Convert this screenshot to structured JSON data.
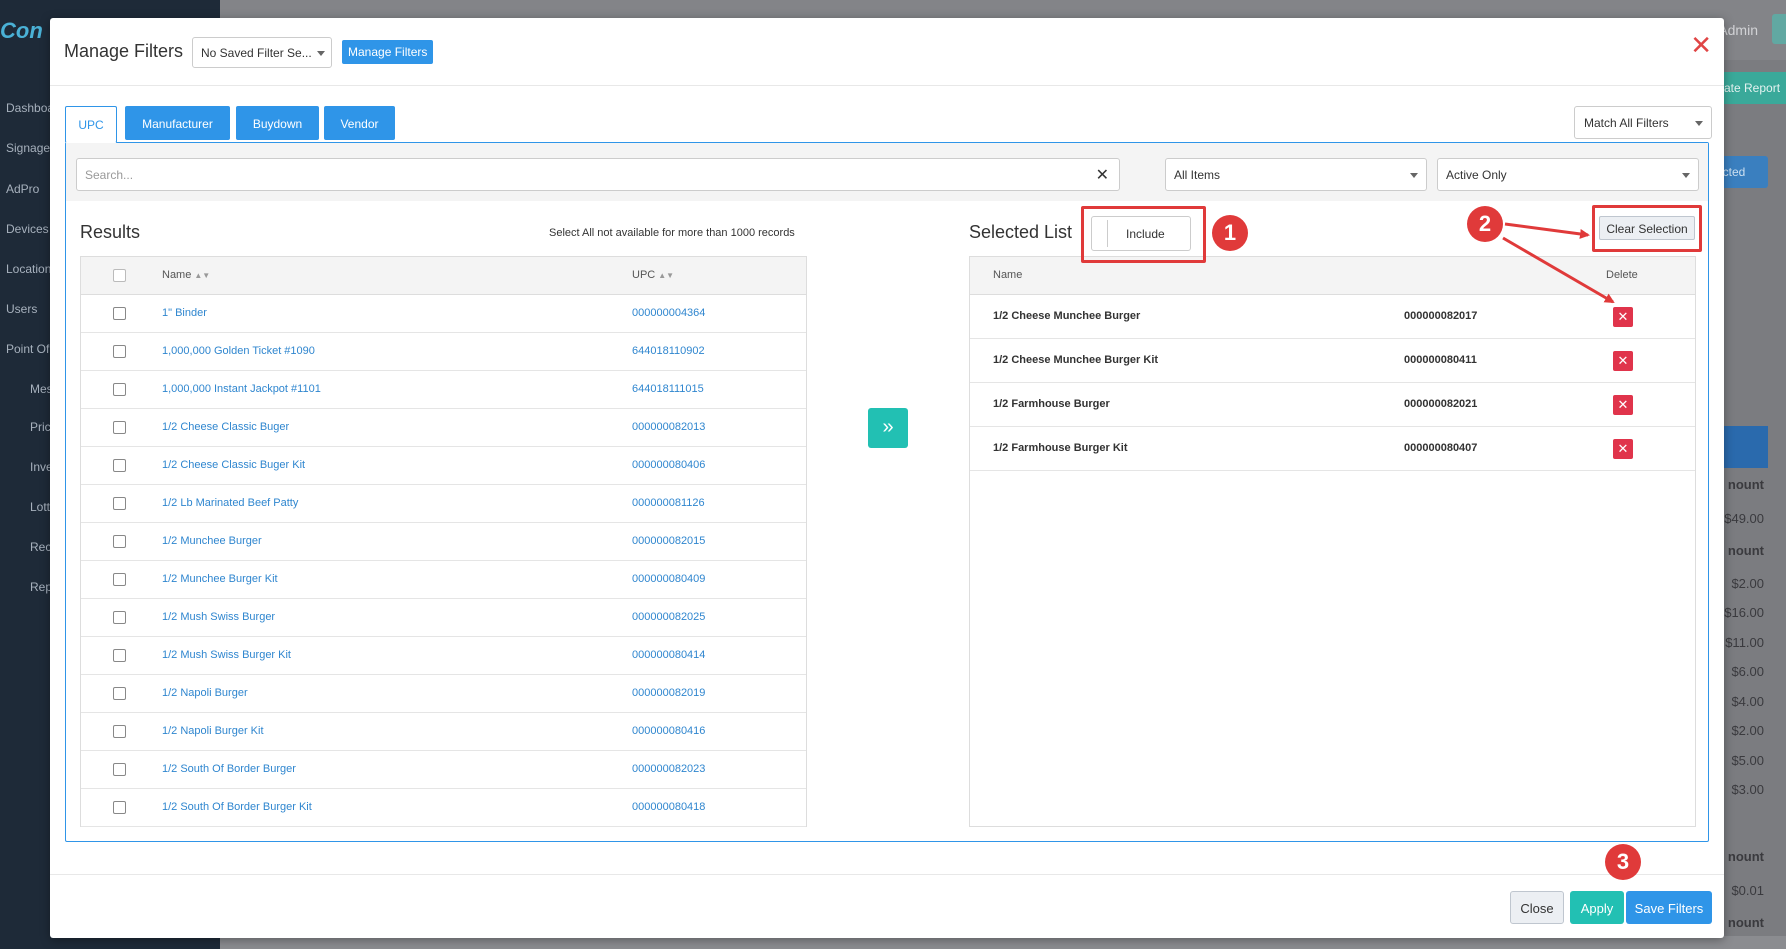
{
  "background": {
    "logo": "Con",
    "admin_label": "Admin",
    "report_btn": "ate Report",
    "selected_btn": "ected",
    "sidebar_items": [
      "Dashboa",
      "Signage",
      "AdPro",
      "Devices",
      "Location",
      "Users",
      "Point Of",
      "Mes",
      "Pric",
      "Inve",
      "Lott",
      "Rec",
      "Rep"
    ],
    "amounts": {
      "h1": "nount",
      "v1": "$49.00",
      "h2": "nount",
      "values": [
        "$2.00",
        "$16.00",
        "$11.00",
        "$6.00",
        "$4.00",
        "$2.00",
        "$5.00",
        "$3.00"
      ],
      "h3": "nount",
      "v3": "$0.01",
      "h4": "nount"
    }
  },
  "modal": {
    "title": "Manage Filters",
    "saved_filter": "No Saved Filter Se...",
    "manage_btn": "Manage Filters",
    "close_icon": "close-icon"
  },
  "tabs": [
    {
      "label": "UPC",
      "active": true
    },
    {
      "label": "Manufacturer",
      "active": false
    },
    {
      "label": "Buydown",
      "active": false
    },
    {
      "label": "Vendor",
      "active": false
    }
  ],
  "match_filter": "Match All Filters",
  "search": {
    "placeholder": "Search..."
  },
  "items_filter": "All Items",
  "status_filter": "Active Only",
  "results": {
    "title": "Results",
    "note": "Select All not available for more than 1000 records",
    "columns": [
      "Name",
      "UPC"
    ],
    "rows": [
      {
        "name": "1\" Binder",
        "upc": "000000004364"
      },
      {
        "name": "1,000,000 Golden Ticket #1090",
        "upc": "644018110902"
      },
      {
        "name": "1,000,000 Instant Jackpot #1101",
        "upc": "644018111015"
      },
      {
        "name": "1/2 Cheese Classic Buger",
        "upc": "000000082013"
      },
      {
        "name": "1/2 Cheese Classic Buger Kit",
        "upc": "000000080406"
      },
      {
        "name": "1/2 Lb Marinated Beef Patty",
        "upc": "000000081126"
      },
      {
        "name": "1/2 Munchee Burger",
        "upc": "000000082015"
      },
      {
        "name": "1/2 Munchee Burger Kit",
        "upc": "000000080409"
      },
      {
        "name": "1/2 Mush Swiss Burger",
        "upc": "000000082025"
      },
      {
        "name": "1/2 Mush Swiss Burger Kit",
        "upc": "000000080414"
      },
      {
        "name": "1/2 Napoli Burger",
        "upc": "000000082019"
      },
      {
        "name": "1/2 Napoli Burger Kit",
        "upc": "000000080416"
      },
      {
        "name": "1/2 South Of Border Burger",
        "upc": "000000082023"
      },
      {
        "name": "1/2 South Of Border Burger Kit",
        "upc": "000000080418"
      }
    ]
  },
  "selected": {
    "title": "Selected List",
    "include_label": "Include",
    "clear_label": "Clear Selection",
    "columns": [
      "Name",
      "Delete"
    ],
    "rows": [
      {
        "name": "1/2 Cheese Munchee Burger",
        "upc": "000000082017"
      },
      {
        "name": "1/2 Cheese Munchee Burger Kit",
        "upc": "000000080411"
      },
      {
        "name": "1/2 Farmhouse Burger",
        "upc": "000000082021"
      },
      {
        "name": "1/2 Farmhouse Burger Kit",
        "upc": "000000080407"
      }
    ]
  },
  "annotations": [
    "1",
    "2",
    "3"
  ],
  "footer": {
    "close": "Close",
    "apply": "Apply",
    "save": "Save Filters"
  },
  "colors": {
    "primary": "#2f95e8",
    "teal": "#22c0b3",
    "danger": "#e0344b",
    "annotation": "#e03a3a"
  }
}
